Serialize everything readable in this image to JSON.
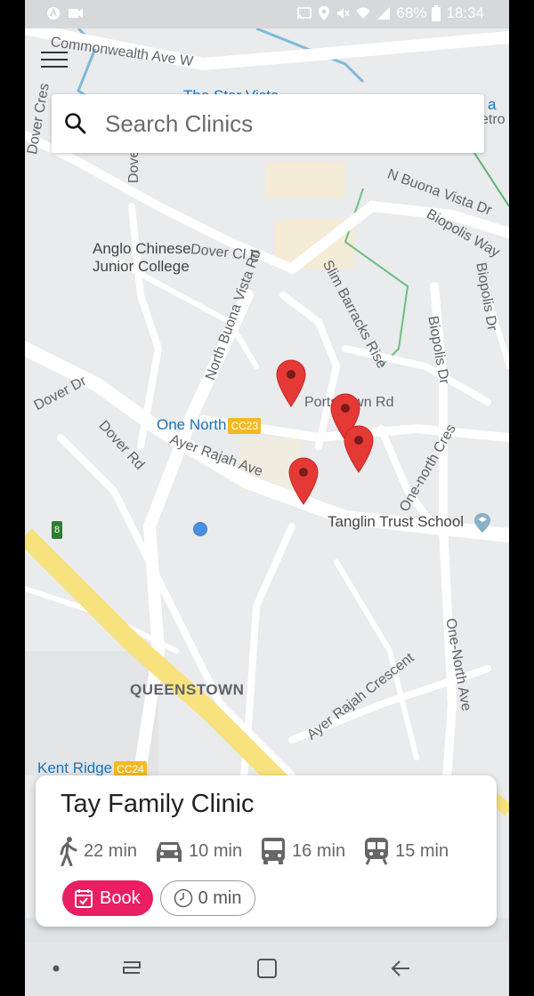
{
  "status_bar": {
    "battery": "68%",
    "time": "18:34"
  },
  "search": {
    "placeholder": "Search Clinics"
  },
  "map": {
    "labels": {
      "commonwealth": "Commonwealth Ave W",
      "star_vista": "The Star Vista",
      "dover_cres": "Dover Cres",
      "dover_rise": "Dover Rise",
      "anglo_chinese_1": "Anglo Chinese",
      "anglo_chinese_2": "Junior College",
      "dover_cl_e": "Dover Cl E",
      "north_buona_vista": "North Buona Vista Rd",
      "n_buona_vista_dr": "N Buona Vista Dr",
      "biopolis_way": "Biopolis Way",
      "biopolis_dr": "Biopolis Dr",
      "biopolis_dr_2": "Biopolis Dr",
      "slim_barracks": "Slim Barracks Rise",
      "dover_dr": "Dover Dr",
      "portsdown": "Portsdown Rd",
      "dover_rd": "Dover Rd",
      "one_north": "One North",
      "one_north_code": "CC23",
      "ayer_rajah_ave": "Ayer Rajah Ave",
      "one_north_cres": "One-north Cres",
      "tanglin": "Tanglin Trust School",
      "queenstown": "QUEENSTOWN",
      "ayer_rajah_crescent": "Ayer Rajah Crescent",
      "one_north_ave": "One-North Ave",
      "kent_ridge": "Kent Ridge",
      "kent_ridge_code": "CC24",
      "expressway_badge": "8",
      "etro_a": "a",
      "etro_b": "etro"
    }
  },
  "clinic_card": {
    "name": "Tay Family Clinic",
    "walk": "22 min",
    "car": "10 min",
    "bus": "16 min",
    "train": "15 min",
    "book_label": "Book",
    "wait_label": "0 min"
  },
  "colors": {
    "accent": "#e91e63",
    "marker": "#e53935",
    "user_dot": "#4a8fe0"
  }
}
